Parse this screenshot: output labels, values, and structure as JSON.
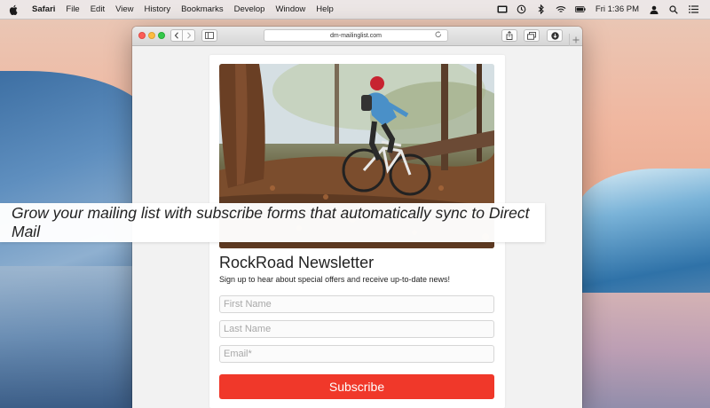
{
  "menubar": {
    "app_name": "Safari",
    "items": [
      "File",
      "Edit",
      "View",
      "History",
      "Bookmarks",
      "Develop",
      "Window",
      "Help"
    ],
    "clock": "Fri 1:36 PM"
  },
  "browser": {
    "url": "dm-mailinglist.com"
  },
  "banner": {
    "text": "Grow your mailing list with subscribe forms that automatically sync to Direct Mail"
  },
  "form": {
    "title": "RockRoad Newsletter",
    "subtitle": "Sign up to hear about special offers and receive up-to-date news!",
    "first_name_placeholder": "First Name",
    "last_name_placeholder": "Last Name",
    "email_placeholder": "Email*",
    "submit_label": "Subscribe"
  },
  "colors": {
    "subscribe_button": "#f0382a",
    "traffic_close": "#fc5d57",
    "traffic_minimize": "#fdbc40",
    "traffic_maximize": "#34c84a"
  },
  "icons": {
    "apple": "apple-icon",
    "back": "chevron-left-icon",
    "forward": "chevron-right-icon",
    "sidebar": "sidebar-icon",
    "reload": "reload-icon",
    "share": "share-icon",
    "tabs": "tabs-overview-icon",
    "download": "download-icon",
    "new_tab": "plus-icon"
  }
}
